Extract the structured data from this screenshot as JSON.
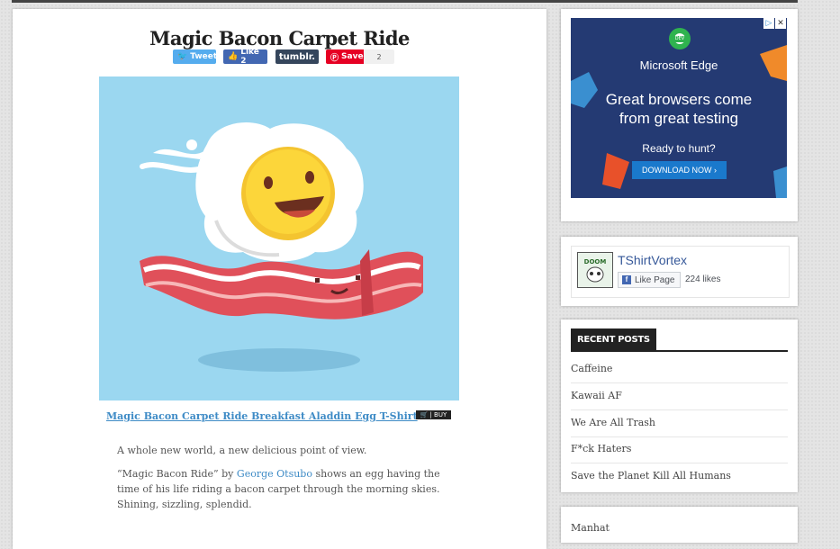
{
  "article": {
    "title": "Magic Bacon Carpet Ride",
    "share": {
      "tweet": "Tweet",
      "like": "Like 2",
      "tumblr": "tumblr.",
      "save": "Save",
      "save_count": "2"
    },
    "product_link": "Magic Bacon Carpet Ride Breakfast Aladdin Egg T-Shirt",
    "buy_badge": "| BUY",
    "para1": "A whole new world, a new delicious point of view.",
    "para2_before": "“Magic Bacon Ride” by ",
    "para2_link": "George Otsubo",
    "para2_after": " shows an egg having the time of his life riding a bacon carpet through the morning skies. Shining, sizzling, splendid."
  },
  "ad": {
    "brand": "Microsoft Edge",
    "logo_tag": "DEV",
    "headline_1": "Great browsers come",
    "headline_2": "from great testing",
    "sub": "Ready to hunt?",
    "button": "DOWNLOAD NOW ›",
    "info": "▷",
    "close": "✕"
  },
  "facebook": {
    "page_name": "TShirtVortex",
    "like_button": "Like Page",
    "like_count": "224 likes"
  },
  "recent_posts": {
    "title": "RECENT POSTS",
    "items": [
      "Caffeine",
      "Kawaii AF",
      "We Are All Trash",
      "F*ck Haters",
      "Save the Planet Kill All Humans"
    ]
  },
  "next_widget": {
    "title": "Manhat"
  },
  "colors": {
    "accent_link": "#3e8bc6",
    "sky": "#9bd7f0",
    "ad_bg": "#243a73"
  }
}
